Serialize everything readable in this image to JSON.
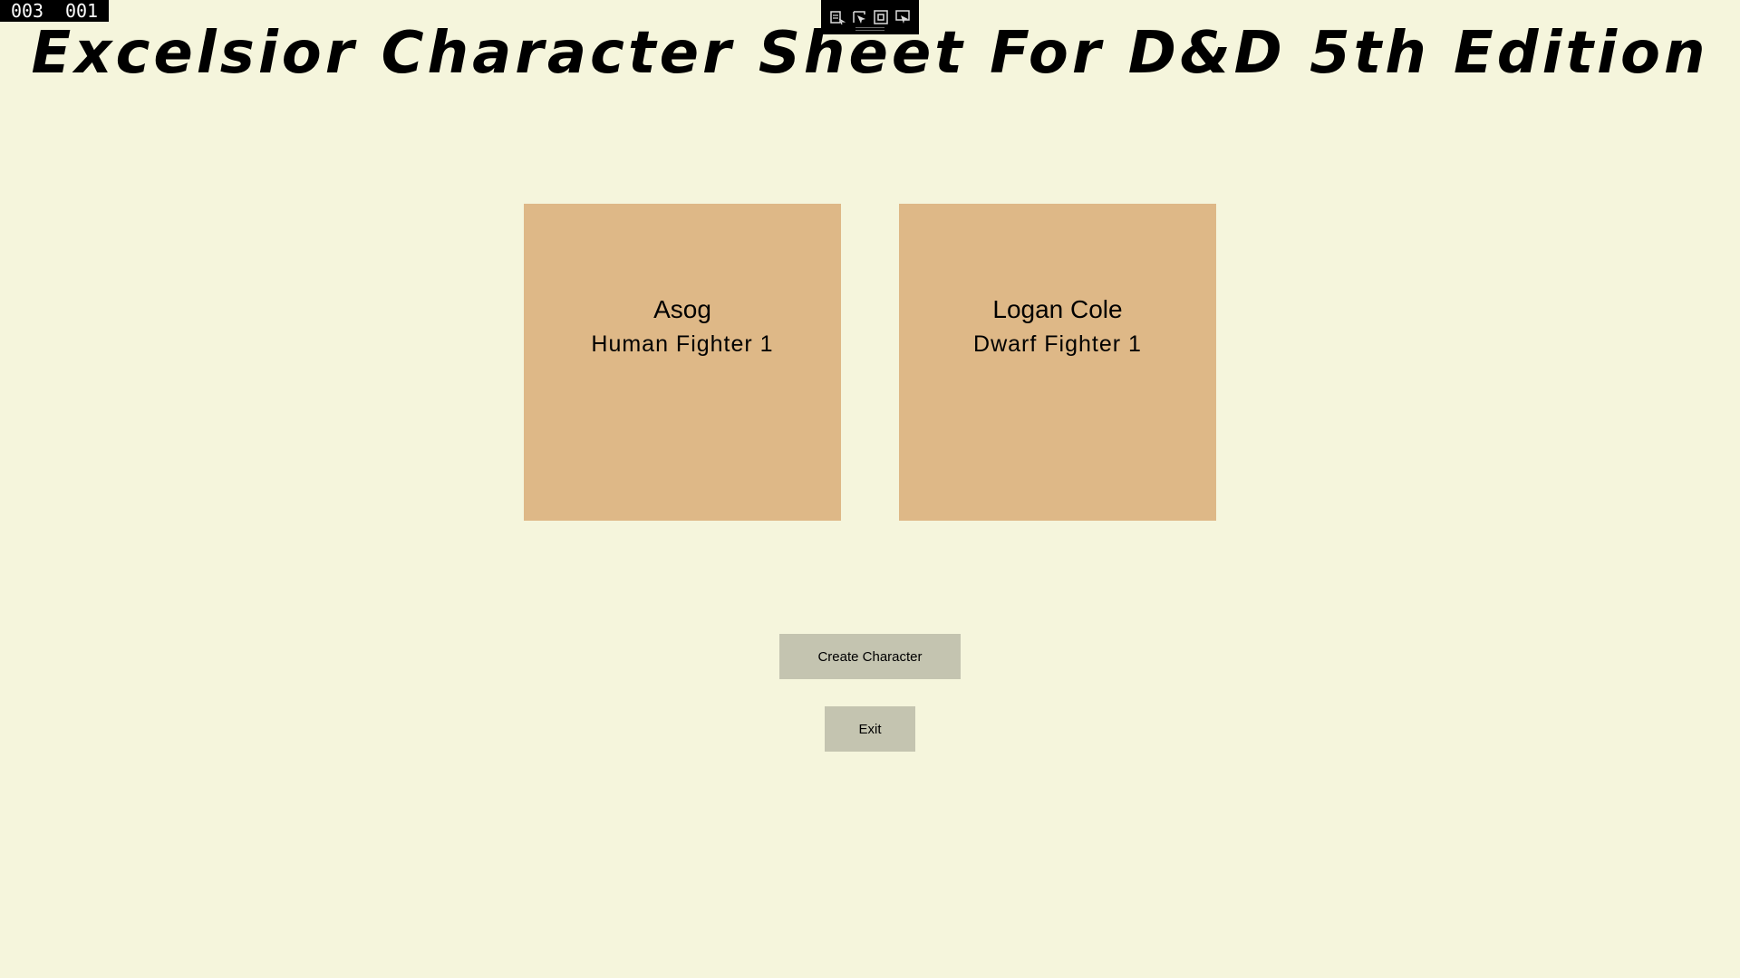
{
  "debug": {
    "fps_left": "003",
    "fps_right": "001",
    "toolbar_icons": [
      "live-tree-icon",
      "select-element-icon",
      "display-layout-adorners-icon",
      "track-focus-icon"
    ]
  },
  "header": {
    "title": "Excelsior Character Sheet For D&D 5th Edition"
  },
  "characters": [
    {
      "name": "Asog",
      "description": "Human Fighter 1"
    },
    {
      "name": "Logan Cole",
      "description": "Dwarf Fighter 1"
    }
  ],
  "actions": {
    "create_label": "Create Character",
    "exit_label": "Exit"
  },
  "colors": {
    "background": "#f5f5dc",
    "card": "#deb887",
    "button": "#c4c4b0"
  }
}
